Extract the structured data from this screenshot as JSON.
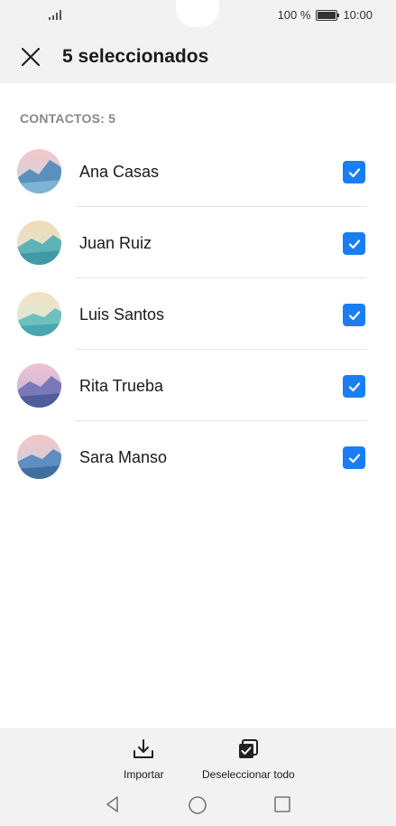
{
  "status_bar": {
    "battery": "100 %",
    "time": "10:00"
  },
  "header": {
    "title": "5 seleccionados"
  },
  "section": {
    "label": "CONTACTOS: 5"
  },
  "contacts": [
    {
      "name": "Ana Casas",
      "selected": true
    },
    {
      "name": "Juan Ruiz",
      "selected": true
    },
    {
      "name": "Luis Santos",
      "selected": true
    },
    {
      "name": "Rita Trueba",
      "selected": true
    },
    {
      "name": "Sara Manso",
      "selected": true
    }
  ],
  "actions": {
    "import_label": "Importar",
    "deselect_label": "Deseleccionar todo"
  },
  "colors": {
    "accent": "#1a7ef2"
  }
}
